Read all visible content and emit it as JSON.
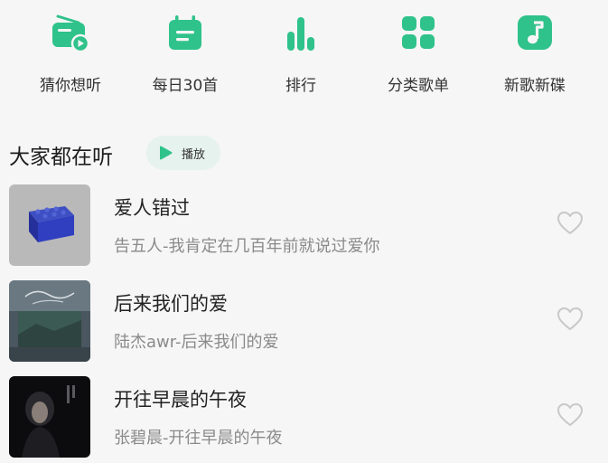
{
  "quick_nav": {
    "accent": "#2fc28b",
    "items": [
      {
        "label": "猜你想听",
        "icon": "radio-icon"
      },
      {
        "label": "每日30首",
        "icon": "calendar-icon"
      },
      {
        "label": "排行",
        "icon": "ranking-bars-icon"
      },
      {
        "label": "分类歌单",
        "icon": "grid-icon"
      },
      {
        "label": "新歌新碟",
        "icon": "music-note-icon"
      }
    ]
  },
  "section": {
    "title": "大家都在听",
    "play_label": "播放"
  },
  "songs": [
    {
      "title": "爱人错过",
      "subtitle": "告五人-我肯定在几百年前就说过爱你",
      "cover": "blue-cube-cover"
    },
    {
      "title": "后来我们的爱",
      "subtitle": "陆杰awr-后来我们的爱",
      "cover": "scenic-cover"
    },
    {
      "title": "开往早晨的午夜",
      "subtitle": "张碧晨-开往早晨的午夜",
      "cover": "portrait-cover"
    }
  ]
}
